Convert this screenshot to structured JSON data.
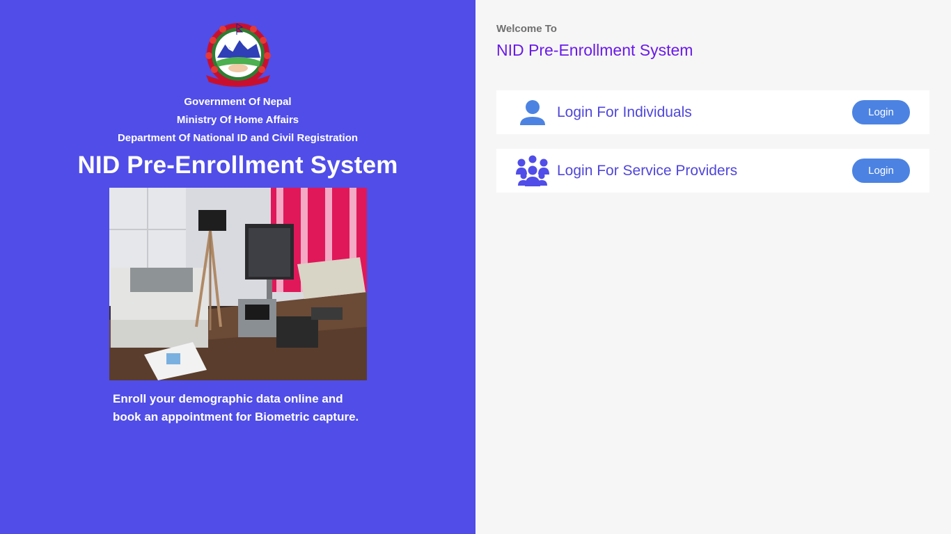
{
  "header": {
    "org_lines": [
      "Government Of Nepal",
      "Ministry Of Home Affairs",
      "Department Of National ID and Civil Registration"
    ],
    "title": "NID Pre-Enrollment System",
    "emblem_icon": "nepal-emblem-icon"
  },
  "tagline": {
    "line1": "Enroll your demographic data online and",
    "line2": "book an appointment for Biometric capture."
  },
  "welcome": {
    "label": "Welcome To",
    "title": "NID Pre-Enrollment System"
  },
  "login_options": [
    {
      "label": "Login For Individuals",
      "button": "Login",
      "icon": "user-icon"
    },
    {
      "label": "Login For Service Providers",
      "button": "Login",
      "icon": "users-group-icon"
    }
  ],
  "colors": {
    "left_panel_bg": "#504DE8",
    "right_panel_bg": "#F6F6F6",
    "title_purple": "#6A1AE8",
    "label_blue": "#4F46DA",
    "button_blue": "#4C83E2"
  }
}
